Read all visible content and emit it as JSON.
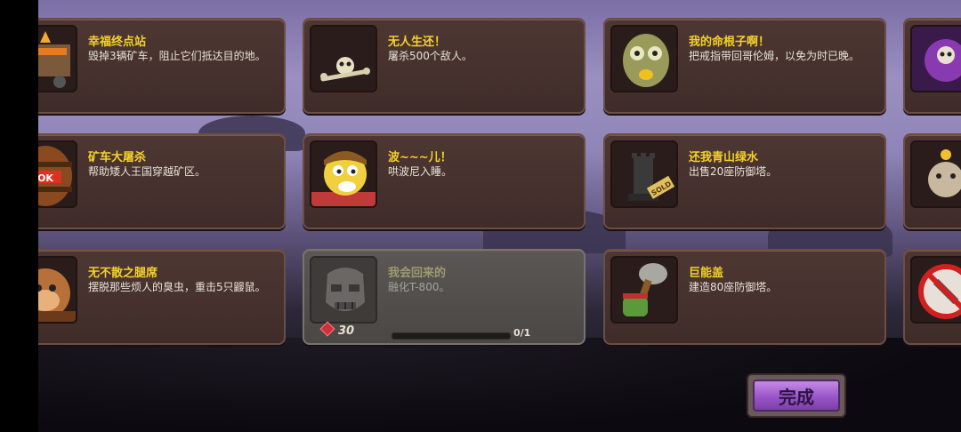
{
  "achievements": [
    {
      "title": "幸福终点站",
      "desc": "毁掉3辆矿车，阻止它们抵达目的地。",
      "icon": "minecart-icon"
    },
    {
      "title": "无人生还！",
      "desc": "屠杀500个敌人。",
      "icon": "bones-icon"
    },
    {
      "title": "我的命根子啊！",
      "desc": "把戒指带回哥伦姆，以免为时已晚。",
      "icon": "gollum-icon"
    },
    {
      "title": "矿车大屠杀",
      "desc": "帮助矮人王国穿越矿区。",
      "icon": "tnt-barrel-icon"
    },
    {
      "title": "波~~~儿！",
      "desc": "哄波尼入睡。",
      "icon": "barney-icon"
    },
    {
      "title": "还我青山绿水",
      "desc": "出售20座防御塔。",
      "icon": "sold-tower-icon"
    },
    {
      "title": "无不散之腿席",
      "desc": "摆脱那些烦人的臭虫，重击5只鼹鼠。",
      "icon": "monkey-icon"
    },
    {
      "title": "我会回来的",
      "desc": "融化T-800。",
      "icon": "terminator-icon",
      "reward": "30",
      "progress": "0/1",
      "progress_value": 0
    },
    {
      "title": "巨能盖",
      "desc": "建造80座防御塔。",
      "icon": "hammer-icon"
    }
  ],
  "done_label": "完成"
}
